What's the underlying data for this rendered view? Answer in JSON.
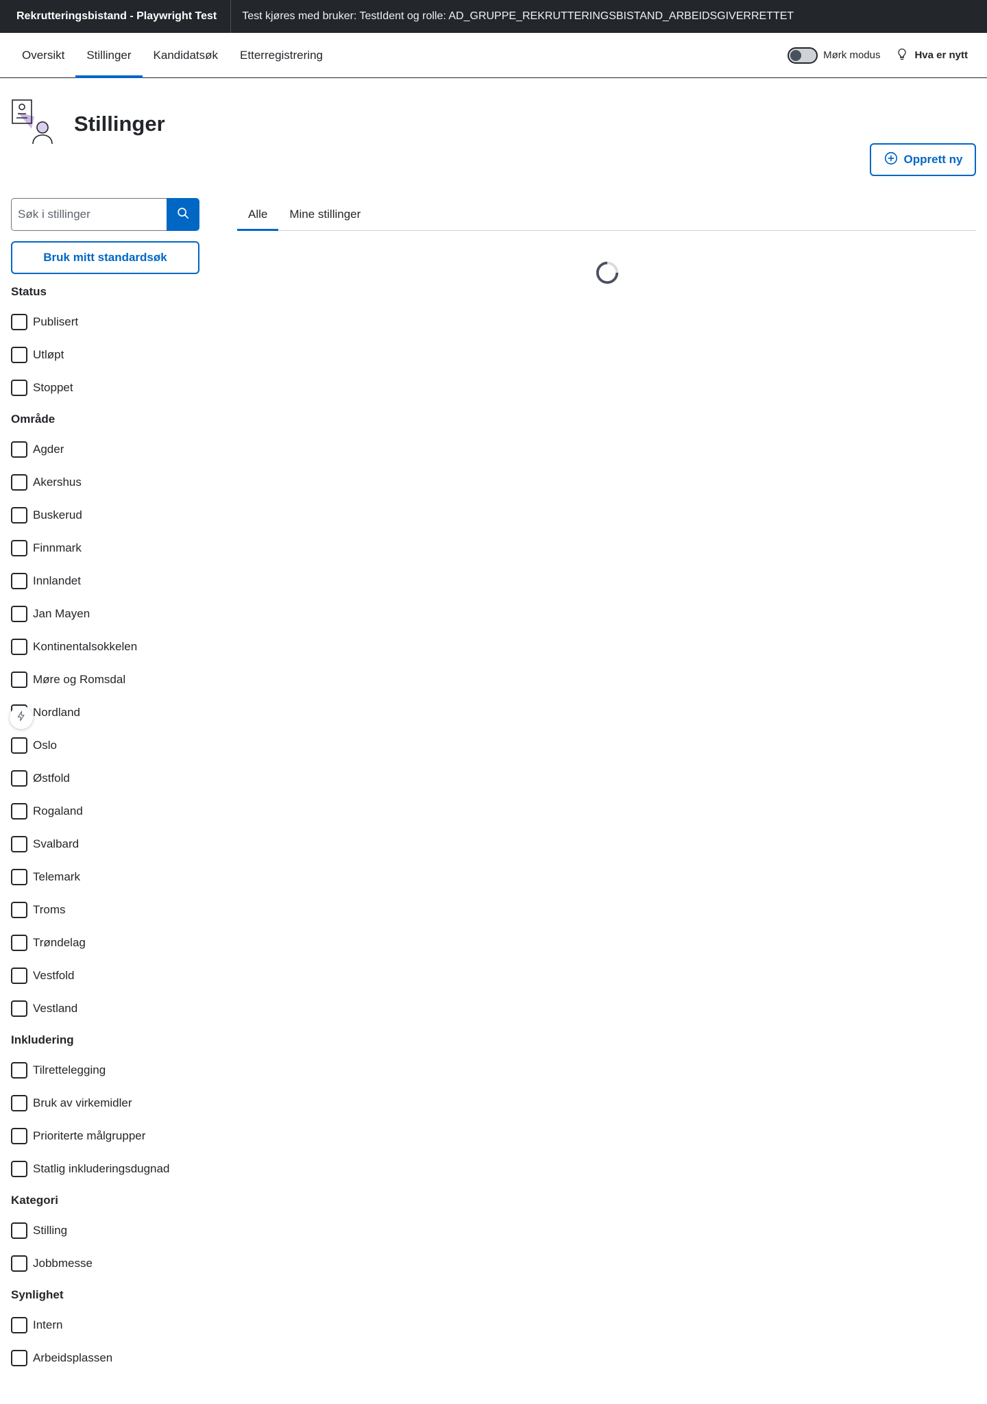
{
  "topbar": {
    "brand": "Rekrutteringsbistand - Playwright Test",
    "user_info": "Test kjøres med bruker: TestIdent og rolle: AD_GRUPPE_REKRUTTERINGSBISTAND_ARBEIDSGIVERRETTET"
  },
  "nav": {
    "tabs": [
      {
        "label": "Oversikt"
      },
      {
        "label": "Stillinger"
      },
      {
        "label": "Kandidatsøk"
      },
      {
        "label": "Etterregistrering"
      }
    ],
    "active_tab": "Stillinger",
    "dark_mode_label": "Mørk modus",
    "dark_mode_on": false,
    "whats_new_label": "Hva er nytt"
  },
  "page": {
    "title": "Stillinger",
    "create_label": "Opprett ny"
  },
  "search": {
    "placeholder": "Søk i stillinger",
    "standard_search_label": "Bruk mitt standardsøk"
  },
  "filters": [
    {
      "title": "Status",
      "options": [
        "Publisert",
        "Utløpt",
        "Stoppet"
      ]
    },
    {
      "title": "Område",
      "options": [
        "Agder",
        "Akershus",
        "Buskerud",
        "Finnmark",
        "Innlandet",
        "Jan Mayen",
        "Kontinentalsokkelen",
        "Møre og Romsdal",
        "Nordland",
        "Oslo",
        "Østfold",
        "Rogaland",
        "Svalbard",
        "Telemark",
        "Troms",
        "Trøndelag",
        "Vestfold",
        "Vestland"
      ]
    },
    {
      "title": "Inkludering",
      "options": [
        "Tilrettelegging",
        "Bruk av virkemidler",
        "Prioriterte målgrupper",
        "Statlig inkluderingsdugnad"
      ]
    },
    {
      "title": "Kategori",
      "options": [
        "Stilling",
        "Jobbmesse"
      ]
    },
    {
      "title": "Synlighet",
      "options": [
        "Intern",
        "Arbeidsplassen"
      ]
    }
  ],
  "main_tabs": [
    {
      "label": "Alle"
    },
    {
      "label": "Mine stillinger"
    }
  ],
  "active_main_tab": "Alle",
  "colors": {
    "accent": "#0067c5",
    "topbar_bg": "#23262a",
    "text": "#23262a"
  }
}
